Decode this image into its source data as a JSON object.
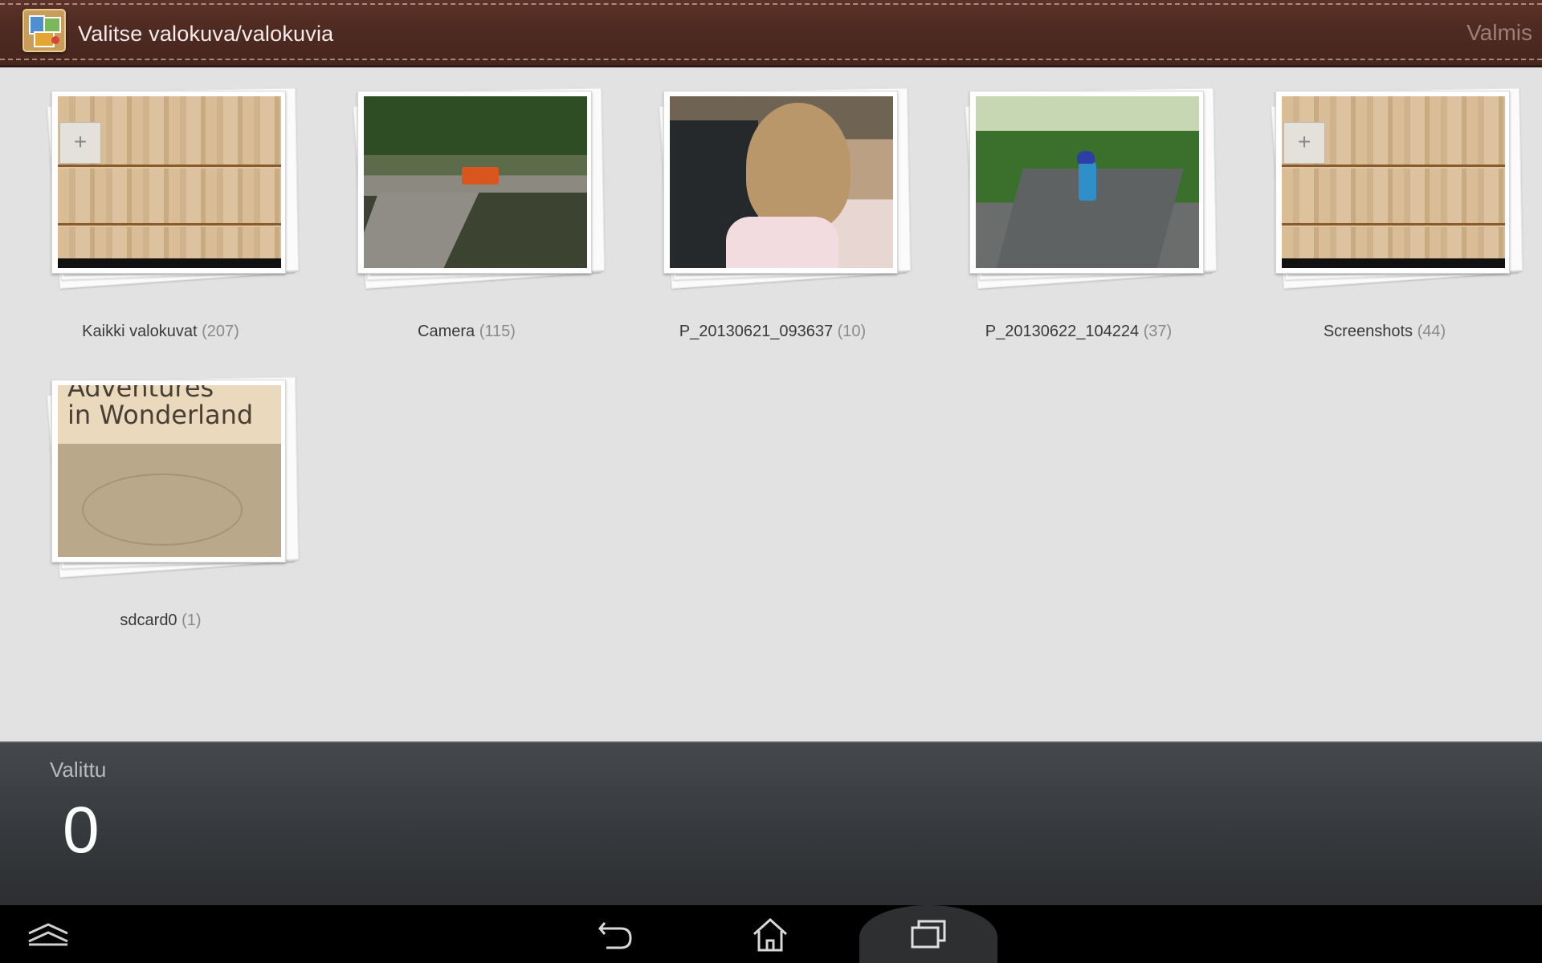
{
  "header": {
    "title": "Valitse valokuva/valokuvia",
    "done_label": "Valmis",
    "app_icon": "gallery-app-icon"
  },
  "albums": [
    {
      "name": "Kaikki valokuvat",
      "count": "(207)",
      "thumbnail": "wood-shelf-screenshot"
    },
    {
      "name": "Camera",
      "count": "(115)",
      "thumbnail": "harbor-pier-photo"
    },
    {
      "name": "P_20130621_093637",
      "count": "(10)",
      "thumbnail": "children-photo"
    },
    {
      "name": "P_20130622_104224",
      "count": "(37)",
      "thumbnail": "child-on-bike-photo"
    },
    {
      "name": "Screenshots",
      "count": "(44)",
      "thumbnail": "wood-shelf-screenshot"
    },
    {
      "name": "sdcard0",
      "count": "(1)",
      "thumbnail": "book-cover"
    }
  ],
  "thumb_text": {
    "book_line1": "Adventures",
    "book_line2": "in Wonderland"
  },
  "selection": {
    "label": "Valittu",
    "count": "0"
  },
  "navbar": {
    "buttons": [
      "hide-navbar-icon",
      "back-icon",
      "home-icon",
      "recent-apps-icon"
    ]
  },
  "colors": {
    "header_bg": "#4e2a22",
    "grid_bg": "#e2e2e2",
    "panel_bg": "#3a3d41",
    "navbar_bg": "#000000"
  }
}
